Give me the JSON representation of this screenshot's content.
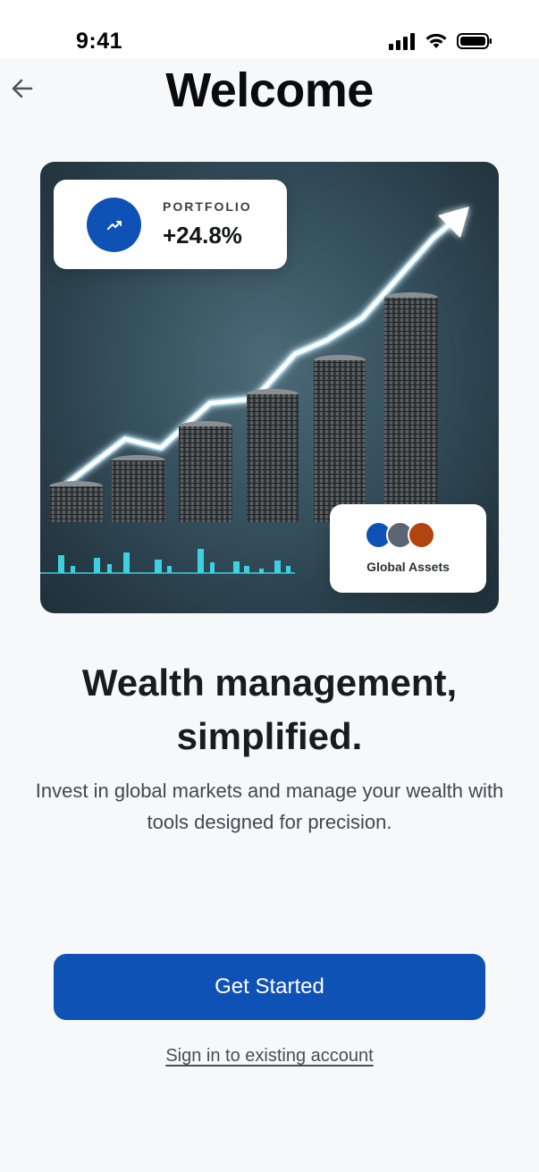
{
  "status_bar": {
    "time": "9:41"
  },
  "header": {
    "title": "Welcome"
  },
  "hero": {
    "portfolio_card": {
      "label": "PORTFOLIO",
      "value": "+24.8%",
      "icon": "trending-up-icon"
    },
    "assets_card": {
      "label": "Global Assets",
      "dot_colors": [
        "#0f52b6",
        "#5d6575",
        "#b2440f"
      ]
    }
  },
  "content": {
    "headline_line1": "Wealth management,",
    "headline_line2": "simplified.",
    "subtext_line1": "Invest in global markets and manage your wealth with",
    "subtext_line2": "tools designed for precision."
  },
  "actions": {
    "primary_label": "Get Started",
    "secondary_label": "Sign in to existing account"
  },
  "colors": {
    "accent": "#0f52b6",
    "background": "#f7f8fa"
  }
}
